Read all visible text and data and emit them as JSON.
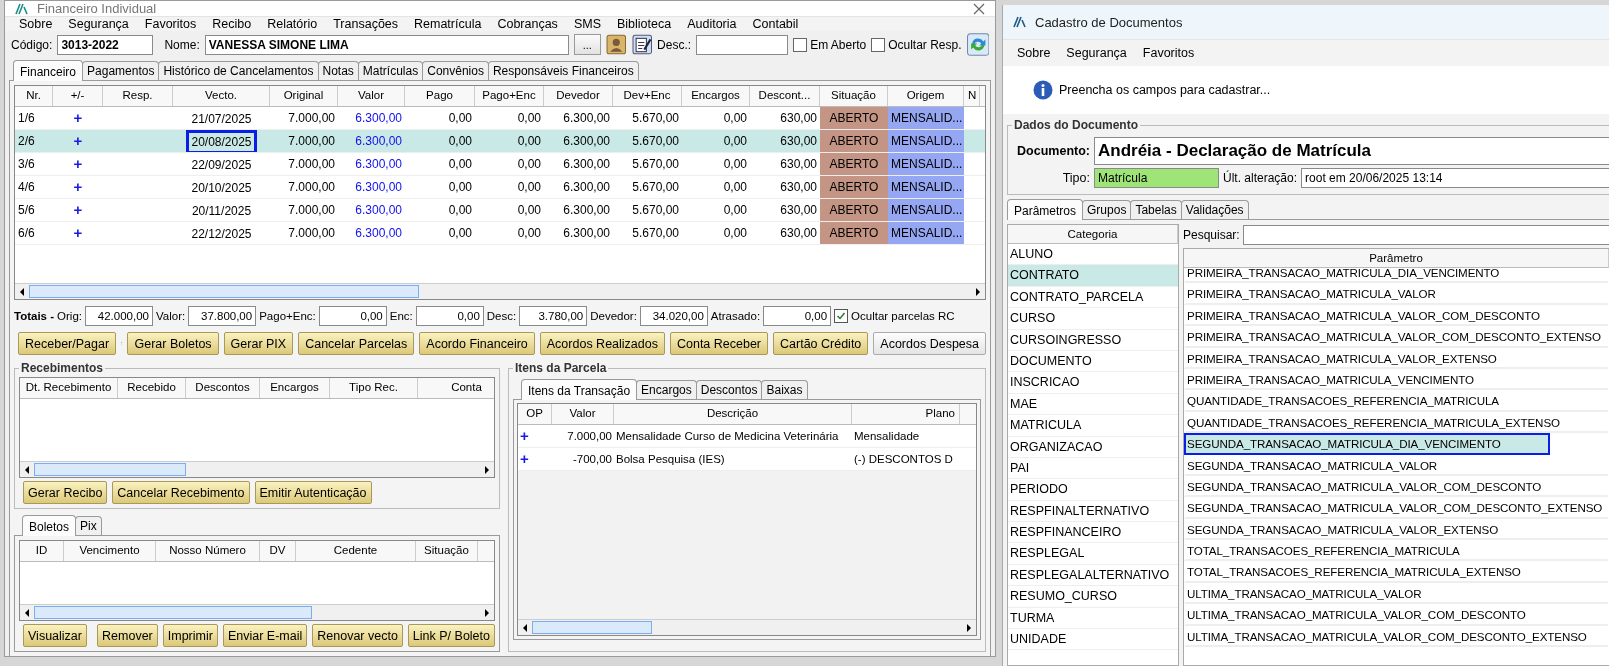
{
  "left_window": {
    "title": "Financeiro Individual",
    "menu": [
      "Sobre",
      "Segurança",
      "Favoritos",
      "Recibo",
      "Relatório",
      "Transações",
      "Rematrícula",
      "Cobranças",
      "SMS",
      "Biblioteca",
      "Auditoria",
      "Contabil"
    ],
    "codigo": {
      "label": "Código:",
      "value": "3013-2022"
    },
    "nome": {
      "label": "Nome:",
      "value": "VANESSA SIMONE LIMA"
    },
    "lookup_button": "...",
    "desc": {
      "label": "Desc.:"
    },
    "filters": [
      {
        "label": "Em Aberto",
        "checked": false
      },
      {
        "label": "Ocultar Resp.",
        "checked": false
      }
    ],
    "tabs": [
      {
        "label": "Financeiro",
        "selected": true
      },
      {
        "label": "Pagamentos",
        "selected": false
      },
      {
        "label": "Histórico de Cancelamentos",
        "selected": false
      },
      {
        "label": "Notas",
        "selected": false
      },
      {
        "label": "Matrículas",
        "selected": false
      },
      {
        "label": "Convênios",
        "selected": false
      },
      {
        "label": "Responsáveis Financeiros",
        "selected": false
      }
    ],
    "installments": {
      "columns": [
        "Nr.",
        "+/-",
        "Resp.",
        "Vecto.",
        "Original",
        "Valor",
        "Pago",
        "Pago+Enc",
        "Devedor",
        "Dev+Enc",
        "Encargos",
        "Descont...",
        "Situação",
        "Origem",
        "N"
      ],
      "rows": [
        {
          "selected": false,
          "framed": false,
          "cells": [
            "1/6",
            "+",
            "",
            "21/07/2025",
            "7.000,00",
            "6.300,00",
            "0,00",
            "0,00",
            "6.300,00",
            "5.670,00",
            "0,00",
            "630,00",
            "ABERTO",
            "MENSALID...",
            ""
          ]
        },
        {
          "selected": true,
          "framed": true,
          "cells": [
            "2/6",
            "+",
            "",
            "20/08/2025",
            "7.000,00",
            "6.300,00",
            "0,00",
            "0,00",
            "6.300,00",
            "5.670,00",
            "0,00",
            "630,00",
            "ABERTO",
            "MENSALID...",
            ""
          ]
        },
        {
          "selected": false,
          "framed": false,
          "cells": [
            "3/6",
            "+",
            "",
            "22/09/2025",
            "7.000,00",
            "6.300,00",
            "0,00",
            "0,00",
            "6.300,00",
            "5.670,00",
            "0,00",
            "630,00",
            "ABERTO",
            "MENSALID...",
            ""
          ]
        },
        {
          "selected": false,
          "framed": false,
          "cells": [
            "4/6",
            "+",
            "",
            "20/10/2025",
            "7.000,00",
            "6.300,00",
            "0,00",
            "0,00",
            "6.300,00",
            "5.670,00",
            "0,00",
            "630,00",
            "ABERTO",
            "MENSALID...",
            ""
          ]
        },
        {
          "selected": false,
          "framed": false,
          "cells": [
            "5/6",
            "+",
            "",
            "20/11/2025",
            "7.000,00",
            "6.300,00",
            "0,00",
            "0,00",
            "6.300,00",
            "5.670,00",
            "0,00",
            "630,00",
            "ABERTO",
            "MENSALID...",
            ""
          ]
        },
        {
          "selected": false,
          "framed": false,
          "cells": [
            "6/6",
            "+",
            "",
            "22/12/2025",
            "7.000,00",
            "6.300,00",
            "0,00",
            "0,00",
            "6.300,00",
            "5.670,00",
            "0,00",
            "630,00",
            "ABERTO",
            "MENSALID...",
            ""
          ]
        }
      ]
    },
    "totals": {
      "label": "Totais -",
      "fields": [
        {
          "label": "Orig:",
          "value": "42.000,00"
        },
        {
          "label": "Valor:",
          "value": "37.800,00"
        },
        {
          "label": "Pago+Enc:",
          "value": "0,00"
        },
        {
          "label": "Enc:",
          "value": "0,00"
        },
        {
          "label": "Desc:",
          "value": "3.780,00"
        },
        {
          "label": "Devedor:",
          "value": "34.020,00"
        },
        {
          "label": "Atrasado:",
          "value": "0,00"
        }
      ],
      "hide_option": {
        "label": "Ocultar parcelas RC",
        "checked": true
      }
    },
    "actions": [
      {
        "kind": "button",
        "label": "Receber/Pagar"
      },
      {
        "kind": "arrow"
      },
      {
        "kind": "button",
        "label": "Gerar Boletos"
      },
      {
        "kind": "button",
        "label": "Gerar PIX"
      },
      {
        "kind": "button",
        "label": "Cancelar Parcelas"
      },
      {
        "kind": "button",
        "label": "Acordo Financeiro"
      },
      {
        "kind": "button",
        "label": "Acordos Realizados"
      },
      {
        "kind": "button",
        "label": "Conta Receber"
      },
      {
        "kind": "button",
        "label": "Cartão Crédito"
      },
      {
        "kind": "plain",
        "label": "Acordos Despesa"
      }
    ],
    "recebimentos": {
      "title": "Recebimentos",
      "columns": [
        "Dt. Recebimento",
        "Recebido",
        "Descontos",
        "Encargos",
        "Tipo Rec.",
        "Conta"
      ],
      "buttons": [
        {
          "kind": "button",
          "label": "Gerar Recibo"
        },
        {
          "kind": "button",
          "label": "Cancelar Recebimento"
        },
        {
          "kind": "button",
          "label": "Emitir Autenticação"
        }
      ]
    },
    "boletos": {
      "tabs": [
        {
          "label": "Boletos",
          "selected": true
        },
        {
          "label": "Pix",
          "selected": false
        }
      ],
      "columns": [
        "ID",
        "Vencimento",
        "Nosso Número",
        "DV",
        "Cedente",
        "Situação"
      ],
      "buttons": [
        {
          "kind": "button",
          "label": "Visualizar"
        },
        {
          "kind": "arrow"
        },
        {
          "kind": "button",
          "label": "Remover"
        },
        {
          "kind": "button",
          "label": "Imprimir"
        },
        {
          "kind": "button",
          "label": "Enviar E-mail"
        },
        {
          "kind": "button",
          "label": "Renovar vecto"
        },
        {
          "kind": "button",
          "label": "Link P/ Boleto"
        }
      ]
    },
    "itens_parcela": {
      "title": "Itens da Parcela",
      "tabs": [
        {
          "label": "Itens da Transação",
          "selected": true
        },
        {
          "label": "Encargos",
          "selected": false
        },
        {
          "label": "Descontos",
          "selected": false
        },
        {
          "label": "Baixas",
          "selected": false
        }
      ],
      "columns": [
        "OP",
        "Valor",
        "Descrição",
        "Plano"
      ],
      "rows": [
        {
          "cells": [
            "+",
            "7.000,00",
            "Mensalidade Curso de Medicina Veterinária",
            "Mensalidade"
          ]
        },
        {
          "cells": [
            "+",
            "-700,00",
            "Bolsa Pesquisa (IES)",
            "(-) DESCONTOS D"
          ]
        }
      ]
    }
  },
  "right_window": {
    "title": "Cadastro de Documentos",
    "menu": [
      "Sobre",
      "Segurança",
      "Favoritos"
    ],
    "info": "Preencha os campos para cadastrar...",
    "group_title": "Dados do Documento",
    "documento": {
      "label": "Documento:",
      "value": "Andréia - Declaração de Matrícula"
    },
    "tipo": {
      "label": "Tipo:",
      "value": "Matrícula"
    },
    "ultima_alteracao": {
      "label": "Últ. alteração:",
      "value": "root em 20/06/2025 13:14"
    },
    "tabs": [
      {
        "label": "Parâmetros",
        "selected": true
      },
      {
        "label": "Grupos",
        "selected": false
      },
      {
        "label": "Tabelas",
        "selected": false
      },
      {
        "label": "Validações",
        "selected": false
      }
    ],
    "category_header": "Categoria",
    "categories": [
      {
        "name": "ALUNO",
        "selected": false
      },
      {
        "name": "CONTRATO",
        "selected": true
      },
      {
        "name": "CONTRATO_PARCELA",
        "selected": false
      },
      {
        "name": "CURSO",
        "selected": false
      },
      {
        "name": "CURSOINGRESSO",
        "selected": false
      },
      {
        "name": "DOCUMENTO",
        "selected": false
      },
      {
        "name": "INSCRICAO",
        "selected": false
      },
      {
        "name": "MAE",
        "selected": false
      },
      {
        "name": "MATRICULA",
        "selected": false
      },
      {
        "name": "ORGANIZACAO",
        "selected": false
      },
      {
        "name": "PAI",
        "selected": false
      },
      {
        "name": "PERIODO",
        "selected": false
      },
      {
        "name": "RESPFINALTERNATIVO",
        "selected": false
      },
      {
        "name": "RESPFINANCEIRO",
        "selected": false
      },
      {
        "name": "RESPLEGAL",
        "selected": false
      },
      {
        "name": "RESPLEGALALTERNATIVO",
        "selected": false
      },
      {
        "name": "RESUMO_CURSO",
        "selected": false
      },
      {
        "name": "TURMA",
        "selected": false
      },
      {
        "name": "UNIDADE",
        "selected": false
      }
    ],
    "search_label": "Pesquisar:",
    "parameter_header": "Parâmetro",
    "parameters": [
      {
        "name": "PRIMEIRA_TRANSACAO_MATRICULA_DIA_VENCIMENTO",
        "selected": false,
        "framed": false
      },
      {
        "name": "PRIMEIRA_TRANSACAO_MATRICULA_VALOR",
        "selected": false,
        "framed": false
      },
      {
        "name": "PRIMEIRA_TRANSACAO_MATRICULA_VALOR_COM_DESCONTO",
        "selected": false,
        "framed": false
      },
      {
        "name": "PRIMEIRA_TRANSACAO_MATRICULA_VALOR_COM_DESCONTO_EXTENSO",
        "selected": false,
        "framed": false
      },
      {
        "name": "PRIMEIRA_TRANSACAO_MATRICULA_VALOR_EXTENSO",
        "selected": false,
        "framed": false
      },
      {
        "name": "PRIMEIRA_TRANSACAO_MATRICULA_VENCIMENTO",
        "selected": false,
        "framed": false
      },
      {
        "name": "QUANTIDADE_TRANSACOES_REFERENCIA_MATRICULA",
        "selected": false,
        "framed": false
      },
      {
        "name": "QUANTIDADE_TRANSACOES_REFERENCIA_MATRICULA_EXTENSO",
        "selected": false,
        "framed": false
      },
      {
        "name": "SEGUNDA_TRANSACAO_MATRICULA_DIA_VENCIMENTO",
        "selected": true,
        "framed": true
      },
      {
        "name": "SEGUNDA_TRANSACAO_MATRICULA_VALOR",
        "selected": false,
        "framed": false
      },
      {
        "name": "SEGUNDA_TRANSACAO_MATRICULA_VALOR_COM_DESCONTO",
        "selected": false,
        "framed": false
      },
      {
        "name": "SEGUNDA_TRANSACAO_MATRICULA_VALOR_COM_DESCONTO_EXTENSO",
        "selected": false,
        "framed": false
      },
      {
        "name": "SEGUNDA_TRANSACAO_MATRICULA_VALOR_EXTENSO",
        "selected": false,
        "framed": false
      },
      {
        "name": "TOTAL_TRANSACOES_REFERENCIA_MATRICULA",
        "selected": false,
        "framed": false
      },
      {
        "name": "TOTAL_TRANSACOES_REFERENCIA_MATRICULA_EXTENSO",
        "selected": false,
        "framed": false
      },
      {
        "name": "ULTIMA_TRANSACAO_MATRICULA_VALOR",
        "selected": false,
        "framed": false
      },
      {
        "name": "ULTIMA_TRANSACAO_MATRICULA_VALOR_COM_DESCONTO",
        "selected": false,
        "framed": false
      },
      {
        "name": "ULTIMA_TRANSACAO_MATRICULA_VALOR_COM_DESCONTO_EXTENSO",
        "selected": false,
        "framed": false
      }
    ]
  }
}
